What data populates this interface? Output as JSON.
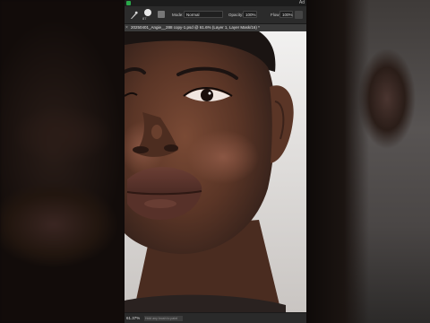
{
  "menubar": {
    "title": "Ad"
  },
  "options_bar": {
    "brush_size": "87",
    "mode_label": "Mode:",
    "mode_value": "Normal",
    "opacity_label": "Opacity:",
    "opacity_value": "100%",
    "flow_label": "Flow:",
    "flow_value": "100%"
  },
  "document": {
    "tab_title": "20250401_Angie__288 copy-1.psd @ 61.6% (Layer 1, Layer Mask/16) *"
  },
  "status": {
    "zoom": "61.37%",
    "message": "Hold any brush to paint"
  },
  "icons": {
    "tool": "brush-icon",
    "close": "close-icon",
    "pressure": "pressure-icon",
    "logo": "photoshop-logo"
  },
  "colors": {
    "accent": "#2aa84a",
    "ui_dark": "#2b2b2b",
    "skin": "#5a3526"
  }
}
